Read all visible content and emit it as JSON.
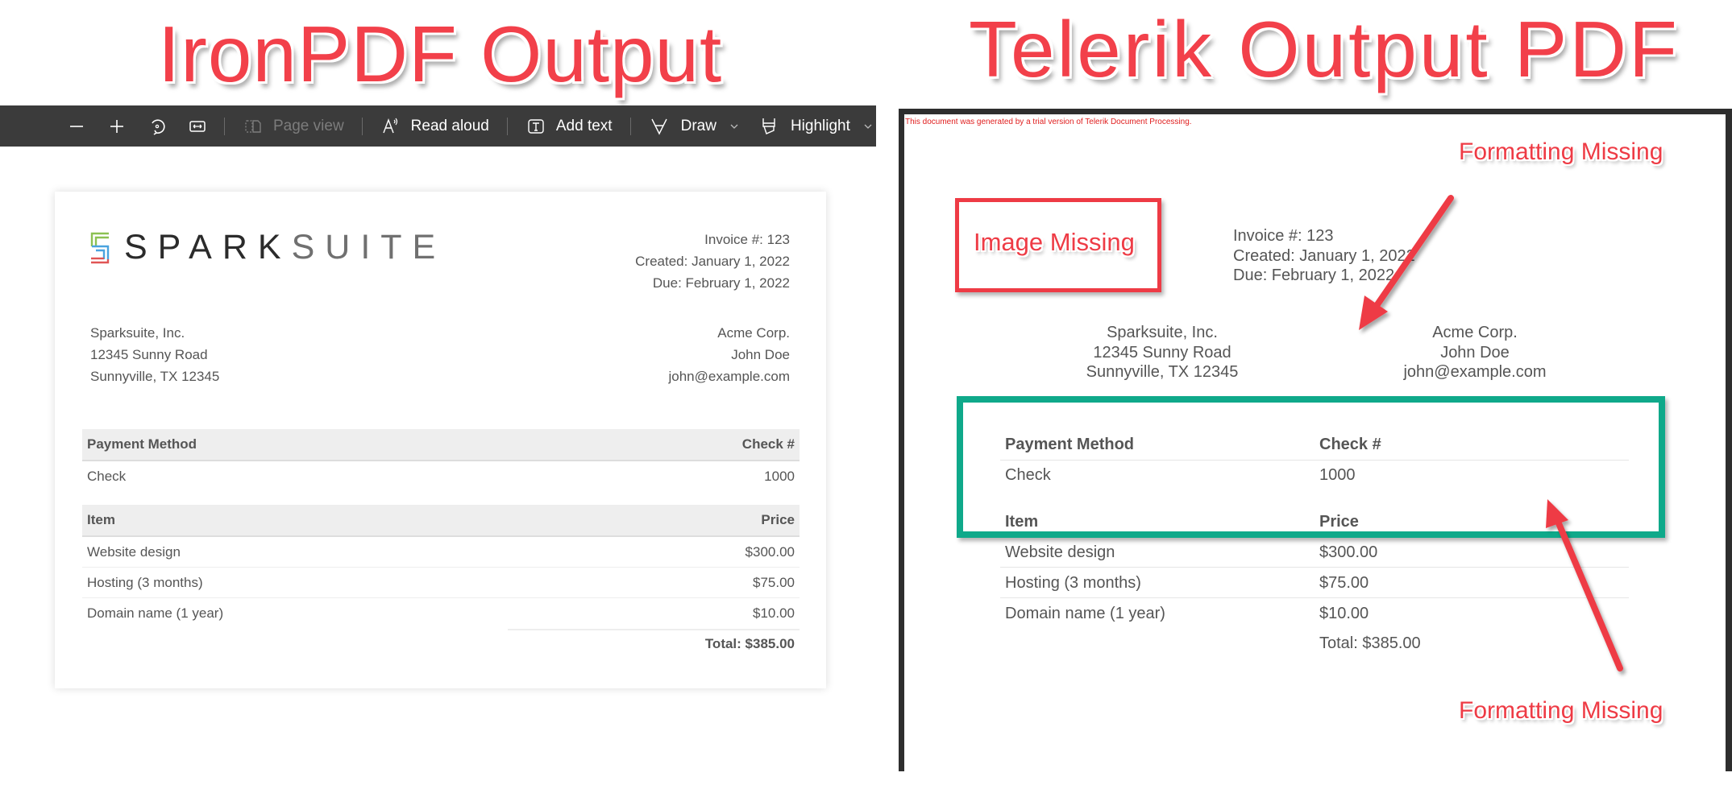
{
  "titles": {
    "left": "IronPDF Output",
    "right": "Telerik Output PDF"
  },
  "toolbar": {
    "zoom_out_icon": "minus-icon",
    "zoom_in_icon": "plus-icon",
    "rotate_icon": "rotate-icon",
    "fit_icon": "fit-width-icon",
    "page_view": "Page view",
    "read_aloud": "Read aloud",
    "add_text": "Add text",
    "draw": "Draw",
    "highlight": "Highlight"
  },
  "invoice": {
    "logo": {
      "spark": "SPARK",
      "suite": "SUITE",
      "colors": {
        "green": "#8cc152",
        "blue": "#4aa3df",
        "red": "#e05555"
      }
    },
    "meta": [
      "Invoice #: 123",
      "Created: January 1, 2022",
      "Due: February 1, 2022"
    ],
    "from": [
      "Sparksuite, Inc.",
      "12345 Sunny Road",
      "Sunnyville, TX 12345"
    ],
    "to": [
      "Acme Corp.",
      "John Doe",
      "john@example.com"
    ],
    "payment": {
      "headers": [
        "Payment Method",
        "Check #"
      ],
      "row": [
        "Check",
        "1000"
      ]
    },
    "items": {
      "headers": [
        "Item",
        "Price"
      ],
      "rows": [
        [
          "Website design",
          "$300.00"
        ],
        [
          "Hosting (3 months)",
          "$75.00"
        ],
        [
          "Domain name (1 year)",
          "$10.00"
        ]
      ],
      "total": "Total: $385.00"
    }
  },
  "telerik": {
    "trial_notice": "This document was generated by a trial version of Telerik Document Processing.",
    "callouts": {
      "image_missing": "Image Missing",
      "formatting_missing_top": "Formatting Missing",
      "formatting_missing_bottom": "Formatting Missing"
    }
  },
  "colors": {
    "title_red": "#f2404a",
    "callout_green": "#0fa98a",
    "toolbar_bg": "#3b3b3b"
  }
}
